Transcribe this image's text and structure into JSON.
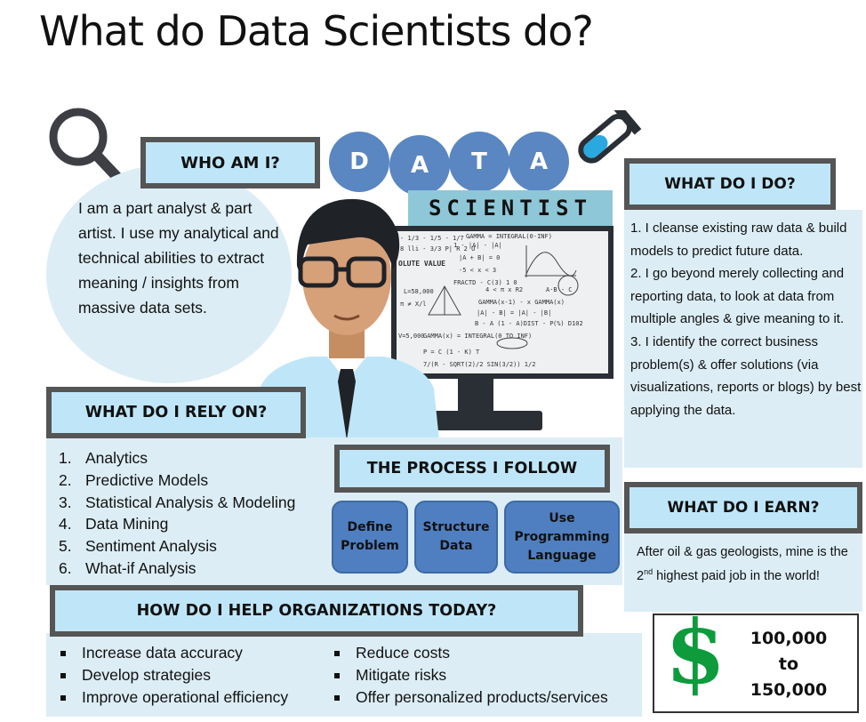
{
  "title": "What do Data Scientists do?",
  "banner": {
    "letters": [
      "D",
      "A",
      "T",
      "A"
    ],
    "subtitle": "SCIENTIST"
  },
  "who": {
    "heading": "WHO AM I?",
    "text": "I am a part analyst & part artist. I use my analytical and technical abilities to extract meaning / insights from massive data sets."
  },
  "do": {
    "heading": "WHAT DO I DO?",
    "items": [
      "1. I cleanse existing raw data & build models to predict future data.",
      "2. I go beyond merely collecting and reporting data, to look at data from multiple angles & give meaning to it.",
      "3. I identify the correct business problem(s)  & offer solutions (via visualizations, reports or blogs) by best applying the data."
    ]
  },
  "rely": {
    "heading": "WHAT DO I RELY ON?",
    "items": [
      {
        "n": "1.",
        "label": "Analytics"
      },
      {
        "n": "2.",
        "label": "Predictive Models"
      },
      {
        "n": "3.",
        "label": "Statistical Analysis & Modeling"
      },
      {
        "n": "4.",
        "label": "Data Mining"
      },
      {
        "n": "5.",
        "label": "Sentiment Analysis"
      },
      {
        "n": "6.",
        "label": "What-if Analysis"
      }
    ]
  },
  "process": {
    "heading": "THE PROCESS I FOLLOW",
    "steps": [
      "Define Problem",
      "Structure Data",
      "Use Programming Language"
    ]
  },
  "earn": {
    "heading": "WHAT DO I EARN?",
    "text_pre": "After oil & gas geologists, mine is the 2",
    "sup": "nd",
    "text_post": " highest paid job in the world!",
    "currency": "$",
    "amount_low": "100,000",
    "to": "to",
    "amount_high": "150,000"
  },
  "help": {
    "heading": "HOW DO I HELP ORGANIZATIONS TODAY?",
    "left": [
      "Increase data accuracy",
      "Develop strategies",
      "Improve operational efficiency"
    ],
    "right": [
      "Reduce costs",
      "Mitigate risks",
      "Offer personalized products/services"
    ]
  },
  "board_text": [
    "- 1/3 - 1/5 - 1/7 -",
    "GAMMA = INTEGRAL(0-INF)",
    "8 lli - 3/3 P| R 2 U",
    "1 - |A| - |A|",
    "OLUTE VALUE",
    "|A + B| = 0",
    "-5 < x < 3",
    "L=58,000",
    "FRACTD - C(3) 1 0",
    "4 < π x R2",
    "A·B - C",
    "GAMMA(x-1) - x GAMMA(x)",
    "π ≠ X/l",
    "|A| - B| = |A| - |B|",
    "B - A (1 - A)DIST - P",
    "(%) D102",
    "V=5,000",
    "GAMMA(x) = INTEGRAL(0 TO INF)",
    "P = C (1 - K) T",
    "7/(R - SQRT(2)/2 SIN(3/2)) 1/2"
  ],
  "colors": {
    "accent_blue": "#5a86c2",
    "header_bg": "#bfe6f8",
    "panel_bg": "#dcedf5",
    "dollar_green": "#0d9b3c",
    "header_border": "#555555"
  },
  "icons": [
    "magnifier-icon",
    "test-tube-icon",
    "data-scientist-illustration",
    "monitor-icon"
  ]
}
